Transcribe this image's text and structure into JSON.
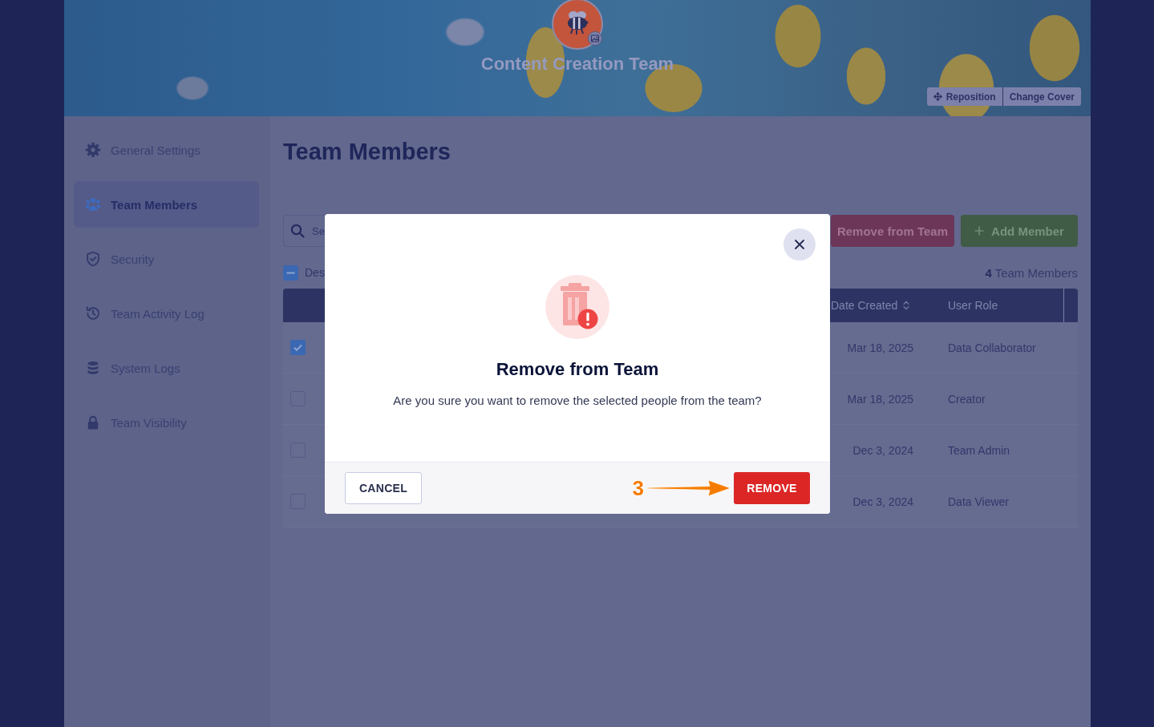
{
  "cover": {
    "title": "Content Creation Team",
    "buttons": [
      {
        "label": "Reposition",
        "kind": "move"
      },
      {
        "label": "Change Cover",
        "kind": "plain"
      }
    ]
  },
  "sidebar": {
    "items": [
      {
        "label": "General Settings",
        "selected": false
      },
      {
        "label": "Team Members",
        "selected": true
      },
      {
        "label": "Security",
        "selected": false
      },
      {
        "label": "Team Activity Log",
        "selected": false
      },
      {
        "label": "System Logs",
        "selected": false
      },
      {
        "label": "Team Visibility",
        "selected": false
      }
    ]
  },
  "page": {
    "title": "Team Members"
  },
  "search": {
    "placeholder": "Se"
  },
  "actions": [
    {
      "label": "Remove from Team",
      "kind": "danger"
    },
    {
      "label": "Add Member",
      "kind": "add"
    }
  ],
  "bulk_select": {
    "label": "Des",
    "checked": true,
    "mixed": true
  },
  "member_count": "**4** Team Members",
  "table": {
    "columns": [
      {
        "label": "Date Created",
        "sortable": true
      },
      {
        "label": "User Role",
        "sortable": false
      }
    ],
    "rows": [
      {
        "checked": true,
        "date_created": "Mar 18, 2025",
        "user_role": "Data Collaborator"
      },
      {
        "checked": false,
        "date_created": "Mar 18, 2025",
        "user_role": "Creator"
      },
      {
        "checked": false,
        "date_created": "Dec 3, 2024",
        "user_role": "Team Admin"
      },
      {
        "checked": false,
        "date_created": "Dec 3, 2024",
        "user_role": "Data Viewer"
      }
    ]
  },
  "dialog": {
    "title": "Remove from Team",
    "message": "Are you sure you want to remove the selected people from the team?",
    "buttons": [
      {
        "label": "CANCEL",
        "kind": "secondary"
      },
      {
        "label": "REMOVE",
        "kind": "danger"
      }
    ]
  },
  "annotation": {
    "label": "3"
  }
}
